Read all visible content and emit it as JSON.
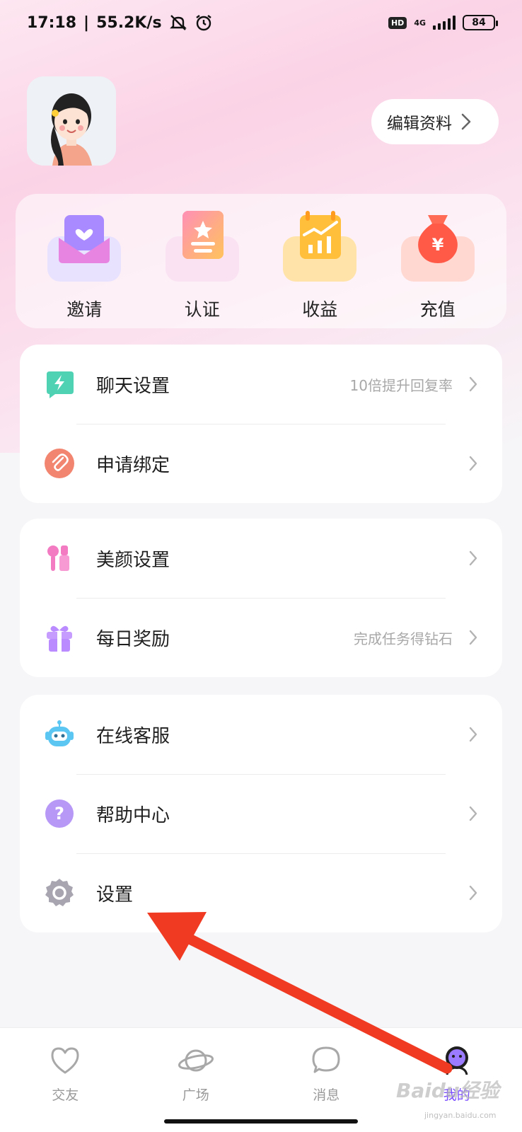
{
  "status_bar": {
    "time": "17:18",
    "speed": "55.2K/s",
    "network": "4G",
    "hd": "HD",
    "battery": "84",
    "icons": [
      "mute-icon",
      "alarm-icon",
      "signal-icon",
      "battery-icon"
    ]
  },
  "profile": {
    "edit_label": "编辑资料",
    "avatar_icon": "avatar-girl-illustration"
  },
  "quick_actions": [
    {
      "label": "邀请",
      "icon": "invite-envelope-icon"
    },
    {
      "label": "认证",
      "icon": "certify-badge-icon"
    },
    {
      "label": "收益",
      "icon": "earnings-chart-icon"
    },
    {
      "label": "充值",
      "icon": "recharge-bag-icon"
    }
  ],
  "menu_groups": [
    [
      {
        "label": "聊天设置",
        "hint": "10倍提升回复率",
        "icon": "chat-lightning-icon"
      },
      {
        "label": "申请绑定",
        "hint": "",
        "icon": "paperclip-icon"
      }
    ],
    [
      {
        "label": "美颜设置",
        "hint": "",
        "icon": "beauty-makeup-icon"
      },
      {
        "label": "每日奖励",
        "hint": "完成任务得钻石",
        "icon": "gift-icon"
      }
    ],
    [
      {
        "label": "在线客服",
        "hint": "",
        "icon": "robot-service-icon"
      },
      {
        "label": "帮助中心",
        "hint": "",
        "icon": "question-icon"
      },
      {
        "label": "设置",
        "hint": "",
        "icon": "gear-icon"
      }
    ]
  ],
  "tabs": [
    {
      "label": "交友",
      "icon": "heart-icon",
      "active": false
    },
    {
      "label": "广场",
      "icon": "planet-icon",
      "active": false
    },
    {
      "label": "消息",
      "icon": "chat-bubble-icon",
      "active": false
    },
    {
      "label": "我的",
      "icon": "profile-face-icon",
      "active": true
    }
  ],
  "watermark": {
    "text": "Baidu经验",
    "url": "jingyan.baidu.com"
  },
  "colors": {
    "accent": "#7a4dff",
    "annotation_arrow": "#f03a22"
  }
}
